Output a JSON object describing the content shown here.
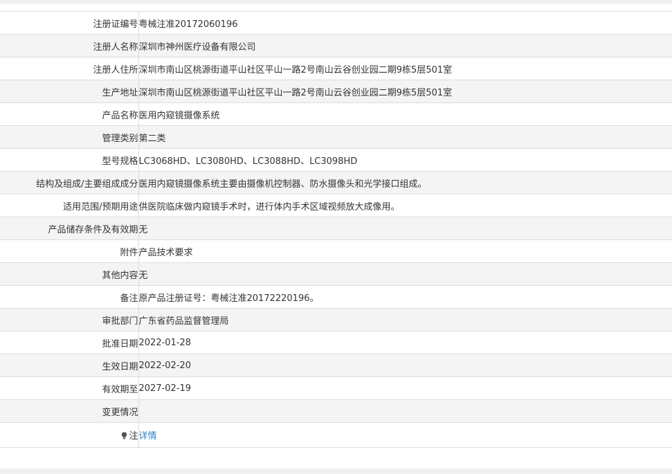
{
  "colors": {
    "border": "#dcdcdc",
    "stripe": "#f4f4f4",
    "text": "#333333",
    "link": "#2f7fc1"
  },
  "rows": [
    {
      "label": "注册证编号",
      "value": "粤械注准20172060196"
    },
    {
      "label": "注册人名称",
      "value": "深圳市神州医疗设备有限公司"
    },
    {
      "label": "注册人住所",
      "value": "深圳市南山区桃源街道平山社区平山一路2号南山云谷创业园二期9栋5层501室"
    },
    {
      "label": "生产地址",
      "value": "深圳市南山区桃源街道平山社区平山一路2号南山云谷创业园二期9栋5层501室"
    },
    {
      "label": "产品名称",
      "value": "医用内窥镜摄像系统"
    },
    {
      "label": "管理类别",
      "value": "第二类"
    },
    {
      "label": "型号规格",
      "value": "LC3068HD、LC3080HD、LC3088HD、LC3098HD"
    },
    {
      "label": "结构及组成/主要组成成分",
      "value": "医用内窥镜摄像系统主要由摄像机控制器、防水摄像头和光学接口组成。"
    },
    {
      "label": "适用范围/预期用途",
      "value": "供医院临床做内窥镜手术时，进行体内手术区域视频放大成像用。"
    },
    {
      "label": "产品储存条件及有效期",
      "value": "无"
    },
    {
      "label": "附件",
      "value": "产品技术要求"
    },
    {
      "label": "其他内容",
      "value": "无"
    },
    {
      "label": "备注",
      "value": "原产品注册证号：粤械注准20172220196。"
    },
    {
      "label": "审批部门",
      "value": "广东省药品监督管理局"
    },
    {
      "label": "批准日期",
      "value": "2022-01-28"
    },
    {
      "label": "生效日期",
      "value": "2022-02-20"
    },
    {
      "label": "有效期至",
      "value": "2027-02-19"
    },
    {
      "label": "变更情况",
      "value": ""
    }
  ],
  "note_row": {
    "icon": "lightbulb-icon",
    "label": "注",
    "link_text": "详情"
  }
}
